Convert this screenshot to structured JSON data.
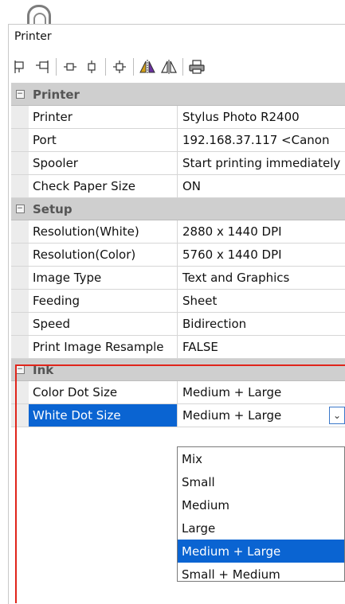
{
  "window": {
    "title": "Printer"
  },
  "toolbar": {
    "icons": [
      "align-left-icon",
      "align-right-icon",
      "align-hcenter-icon",
      "align-vcenter-icon",
      "center-icon",
      "flip-horizontal-color-icon",
      "flip-horizontal-icon",
      "print-icon"
    ]
  },
  "categories": {
    "printer": "Printer",
    "setup": "Setup",
    "ink": "Ink"
  },
  "rows": {
    "printer": {
      "label": "Printer",
      "value": "Stylus Photo R2400"
    },
    "port": {
      "label": "Port",
      "value": "192.168.37.117   <Canon"
    },
    "spooler": {
      "label": "Spooler",
      "value": "Start printing immediately"
    },
    "check_paper": {
      "label": "Check Paper Size",
      "value": "ON"
    },
    "res_white": {
      "label": "Resolution(White)",
      "value": "2880 x 1440 DPI"
    },
    "res_color": {
      "label": "Resolution(Color)",
      "value": "5760 x 1440 DPI"
    },
    "image_type": {
      "label": "Image Type",
      "value": "Text and Graphics"
    },
    "feeding": {
      "label": "Feeding",
      "value": "Sheet"
    },
    "speed": {
      "label": "Speed",
      "value": "Bidirection"
    },
    "resample": {
      "label": "Print Image Resample",
      "value": "FALSE"
    },
    "color_dot": {
      "label": "Color Dot Size",
      "value": "Medium + Large"
    },
    "white_dot": {
      "label": "White Dot Size",
      "value": "Medium + Large"
    }
  },
  "dropdown": {
    "options": [
      "Mix",
      "Small",
      "Medium",
      "Large",
      "Medium + Large",
      "Small + Medium"
    ],
    "selected": "Medium + Large",
    "arrow": "⌄"
  },
  "colors": {
    "selection": "#0a64d2",
    "highlight_border": "#e0251b",
    "category_bg": "#cfcfcf"
  }
}
